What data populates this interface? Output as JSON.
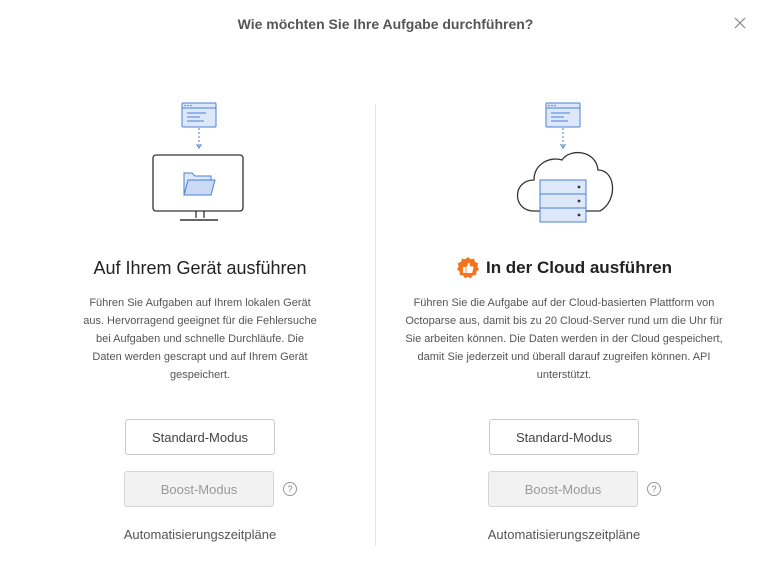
{
  "dialog": {
    "title": "Wie möchten Sie Ihre Aufgabe durchführen?",
    "close_label": "×"
  },
  "local": {
    "title": "Auf Ihrem Gerät ausführen",
    "description": "Führen Sie Aufgaben auf Ihrem lokalen Gerät aus. Hervorragend geeignet für die Fehlersuche bei Aufgaben und schnelle Durchläufe. Die Daten werden gescrapt und auf Ihrem Gerät gespeichert.",
    "standard_label": "Standard-Modus",
    "boost_label": "Boost-Modus",
    "help_label": "?",
    "schedule_label": "Automatisierungszeitpläne"
  },
  "cloud": {
    "title": "In der Cloud ausführen",
    "description": "Führen Sie die Aufgabe auf der Cloud-basierten Plattform von Octoparse aus, damit bis zu 20 Cloud-Server rund um die Uhr für Sie arbeiten können. Die Daten werden in der Cloud gespeichert, damit Sie jederzeit und überall darauf zugreifen können. API unterstützt.",
    "standard_label": "Standard-Modus",
    "boost_label": "Boost-Modus",
    "help_label": "?",
    "schedule_label": "Automatisierungszeitpläne",
    "badge_icon": "thumbs-up-badge-icon",
    "badge_color": "#f5731b"
  },
  "colors": {
    "accent_blue": "#4a7fd6",
    "illustration_fill": "#dde8fb"
  }
}
